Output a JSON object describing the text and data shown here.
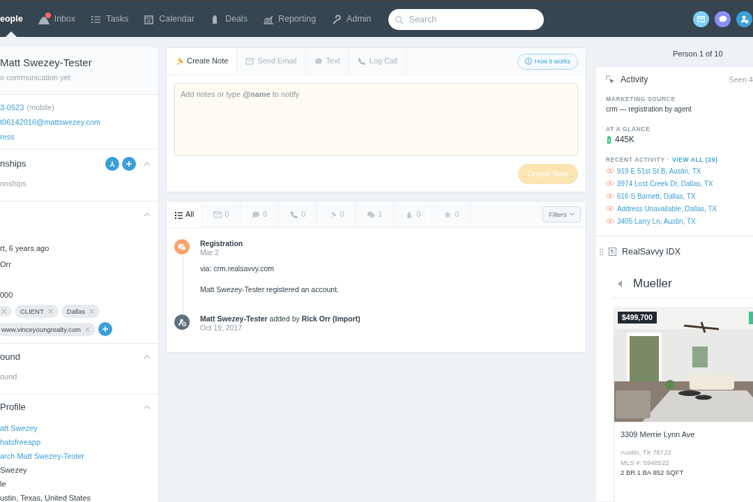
{
  "nav": {
    "items": [
      {
        "label": "eople",
        "selected": true,
        "unread": false
      },
      {
        "label": "Inbox",
        "selected": false,
        "unread": true
      },
      {
        "label": "Tasks",
        "selected": false,
        "unread": false
      },
      {
        "label": "Calendar",
        "selected": false,
        "unread": false
      },
      {
        "label": "Deals",
        "selected": false,
        "unread": false
      },
      {
        "label": "Reporting",
        "selected": false,
        "unread": false
      },
      {
        "label": "Admin",
        "selected": false,
        "unread": false
      }
    ],
    "search": {
      "placeholder": "Search"
    }
  },
  "contact_panel": {
    "name": "Matt Swezey-Tester",
    "status": "o communication yet",
    "contacts": [
      {
        "kind": "phone",
        "value": "3-0523",
        "note": "(mobile)"
      },
      {
        "kind": "link",
        "value": "t06142016@mattswezey.com"
      },
      {
        "kind": "link",
        "value": "ress"
      }
    ],
    "sections": [
      {
        "title": "nships",
        "expanded": true,
        "actions": true,
        "rows": [
          {
            "kind": "muted",
            "text": "onships"
          }
        ]
      },
      {
        "expanded": true,
        "rows": [
          {
            "kind": "detail",
            "text": "rt, 6 years ago"
          },
          {
            "kind": "plain",
            "text": "Orr"
          },
          {
            "kind": "detail",
            "text": "000"
          },
          {
            "kind": "tags",
            "tags": [
              {
                "kind": "cut"
              },
              {
                "kind": "labeled",
                "label": "CLIENT"
              },
              {
                "kind": "labeled",
                "label": "Dallas"
              },
              {
                "kind": "labeled",
                "label": "www.vinceyoungrealty.com"
              }
            ]
          }
        ]
      },
      {
        "title": "ound",
        "expanded": true,
        "rows": [
          {
            "kind": "muted",
            "text": "ound"
          }
        ]
      },
      {
        "title": "Profile",
        "expanded": true,
        "rows": [
          {
            "kind": "link",
            "text": "att Swezey"
          },
          {
            "kind": "link",
            "text": "hatsfreeapp"
          },
          {
            "kind": "link",
            "text": "arch Matt Swezey-Tester"
          },
          {
            "kind": "plain",
            "text": "Swezey"
          },
          {
            "kind": "plain",
            "text": "le"
          },
          {
            "kind": "plain",
            "text": "ustin, Texas, United States"
          }
        ]
      }
    ]
  },
  "composer": {
    "tabs": [
      {
        "label": "Create Note",
        "selected": true
      },
      {
        "label": "Send Email",
        "selected": false
      },
      {
        "label": "Text",
        "selected": false
      },
      {
        "label": "Log Call",
        "selected": false
      }
    ],
    "help_button": "How it works",
    "placeholder": "Add notes or type **@name** to notify",
    "submit": {
      "label": "Create Note",
      "disabled": true
    }
  },
  "timeline": {
    "filters": [
      {
        "label": "All",
        "selected": true
      },
      {
        "label": "0",
        "selected": false
      },
      {
        "label": "0",
        "selected": false
      },
      {
        "label": "0",
        "selected": false
      },
      {
        "label": "0",
        "selected": false
      },
      {
        "label": "1",
        "selected": false
      },
      {
        "label": "0",
        "selected": false
      },
      {
        "label": "0",
        "selected": false
      }
    ],
    "filters_button": "Filters",
    "events": [
      {
        "kind": "registration",
        "color": "#f9a46e",
        "title": "**Registration**",
        "date": "Mar 2",
        "lines": [
          "via: crm.realsavvy.com",
          "Matt Swezey-Tester registered an account."
        ]
      },
      {
        "kind": "added",
        "color": "#5f7080",
        "title": "**Matt Swezey-Tester** added by **Rick Orr (Import)**",
        "date": "Oct 19, 2017"
      }
    ]
  },
  "side": {
    "pager": "Person 1 of 10",
    "activity": {
      "title": "Activity",
      "seen": "Seen 4",
      "marketing_label": "MARKETING SOURCE",
      "marketing_value": "crm — registration by agent",
      "glance_label": "AT A GLANCE",
      "glance_value": "445K",
      "recent_label": "RECENT ACTIVITY ·",
      "view_all": "VIEW ALL (29)",
      "recent": [
        "919 E 51st St B, Austin, TX",
        "3974 Lost Creek Dr, Dallas, TX",
        "616 S Barnett, Dallas, TX",
        "Address Unavailable, Dallas, TX",
        "3405 Larry Ln, Austin, TX"
      ]
    },
    "idx": {
      "title": "RealSavvy IDX",
      "area": "Mueller",
      "listing": {
        "price": "$499,700",
        "address": "3309 Merrie Lynn Ave",
        "city": "Austin, TX 78722",
        "mls": "MLS #: 5948522",
        "specs": "2 BR 1 BA 852 SQFT"
      }
    }
  }
}
